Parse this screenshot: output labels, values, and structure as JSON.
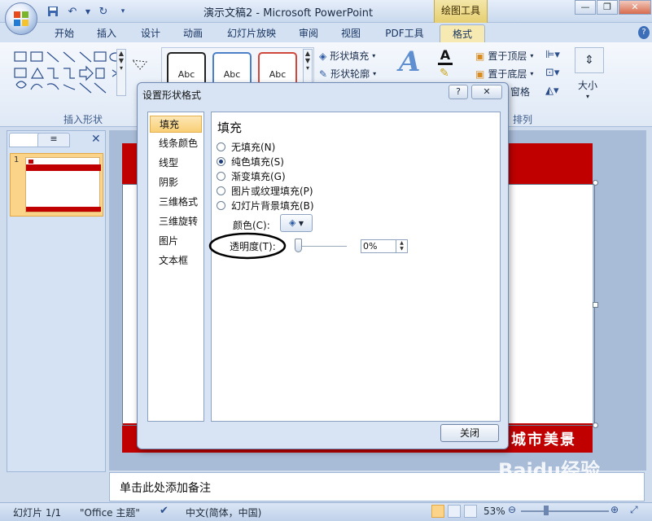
{
  "window": {
    "title": "演示文稿2 - Microsoft PowerPoint",
    "context_title": "绘图工具"
  },
  "tabs": [
    "开始",
    "插入",
    "设计",
    "动画",
    "幻灯片放映",
    "审阅",
    "视图",
    "PDF工具",
    "格式"
  ],
  "ribbon": {
    "insert_shapes_label": "插入形状",
    "arrange_label": "排列",
    "style_sample": "Abc",
    "shape_fill": "形状填充",
    "shape_outline": "形状轮廓",
    "bring_front": "置于顶层",
    "send_back": "置于底层",
    "pane": "窗格",
    "size": "大小"
  },
  "dialog": {
    "title": "设置形状格式",
    "help": "?",
    "close_x": "✕",
    "nav": [
      "填充",
      "线条颜色",
      "线型",
      "阴影",
      "三维格式",
      "三维旋转",
      "图片",
      "文本框"
    ],
    "heading": "填充",
    "options": [
      "无填充(N)",
      "纯色填充(S)",
      "渐变填充(G)",
      "图片或纹理填充(P)",
      "幻灯片背景填充(B)"
    ],
    "color_label": "颜色(C):",
    "transparency_label": "透明度(T):",
    "transparency_value": "0%",
    "close_button": "关闭"
  },
  "slide": {
    "banner_text": "城市美景",
    "thumb_number": "1"
  },
  "notes": {
    "placeholder": "单击此处添加备注"
  },
  "status": {
    "slide": "幻灯片 1/1",
    "theme": "\"Office 主题\"",
    "language": "中文(简体，中国)",
    "zoom": "53%"
  },
  "watermark": "Baidu经验",
  "colors": {
    "banner_red": "#c00000",
    "selection_orange": "#f8cf75",
    "ribbon_blue": "#dfe9f6"
  }
}
